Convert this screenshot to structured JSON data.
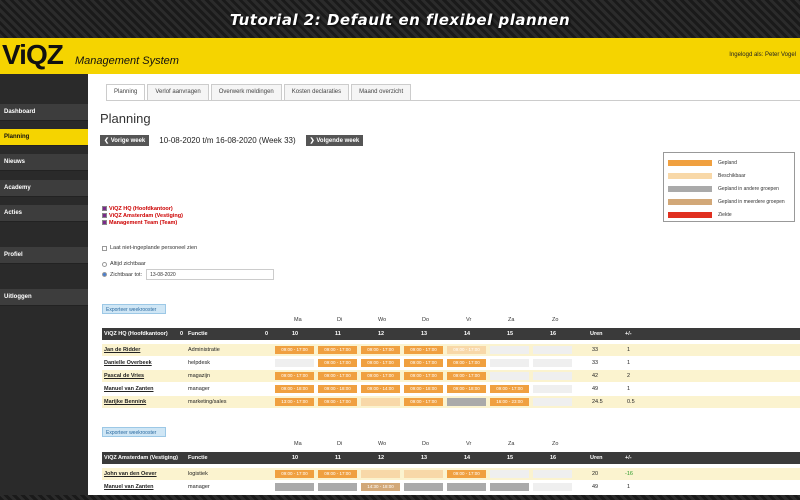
{
  "banner": {
    "title": "Tutorial 2: Default en flexibel plannen"
  },
  "header": {
    "logo": "ViQZ",
    "system_title": "Management System",
    "login_info": "Ingelogd als: Peter Vogel"
  },
  "sidebar": {
    "items": [
      "Dashboard",
      "Planning",
      "Nieuws",
      "Academy",
      "Acties",
      "Profiel",
      "Uitloggen"
    ],
    "active": "Planning"
  },
  "tabs": [
    "Planning",
    "Verlof aanvragen",
    "Overwerk meldingen",
    "Kosten declaraties",
    "Maand overzicht"
  ],
  "page": {
    "title": "Planning",
    "prev_week": "Vorige week",
    "week_range": "10-08-2020 t/m 16-08-2020   (Week 33)",
    "next_week": "Volgende week"
  },
  "legend": [
    {
      "label": "Gepland",
      "color": "#f0a040"
    },
    {
      "label": "Beschikbaar",
      "color": "#f8d8a8"
    },
    {
      "label": "Gepland in andere groepen",
      "color": "#aaaaaa"
    },
    {
      "label": "Gepland in meerdere groepen",
      "color": "#d2a878"
    },
    {
      "label": "Ziekte",
      "color": "#e03020"
    }
  ],
  "groups": [
    "ViQZ HQ (Hoofdkantoor)",
    "ViQZ Amsterdam (Vestiging)",
    "Management Team (Team)"
  ],
  "options": {
    "show_unplanned": "Laat niet-ingeplande personeel zien",
    "always_visible": "Altijd zichtbaar",
    "visible_until": "Zichtbaar tot:",
    "visible_until_date": "13-08-2020"
  },
  "export_label": "Exporteer weekrooster",
  "days": [
    "Ma",
    "Di",
    "Wo",
    "Do",
    "Vr",
    "Za",
    "Zo"
  ],
  "dates": [
    "10",
    "11",
    "12",
    "13",
    "14",
    "15",
    "16"
  ],
  "col_function": "Functie",
  "col_hours": "Uren",
  "col_diff": "+/-",
  "tables": [
    {
      "group": "ViQZ HQ (Hoofdkantoor)",
      "count": "0",
      "count2": "0",
      "rows": [
        {
          "name": "Jan de Ridder",
          "function": "Administratie",
          "hours": "33",
          "diff": "1",
          "cells": [
            [
              "gepland",
              "09:00 - 17:00"
            ],
            [
              "gepland",
              "09:00 - 17:00"
            ],
            [
              "gepland",
              "09:00 - 17:00"
            ],
            [
              "gepland",
              "09:00 - 17:00"
            ],
            [
              "beschikbaar",
              "09:00 - 17:00"
            ],
            [
              "leeg",
              ""
            ],
            [
              "leeg",
              ""
            ]
          ]
        },
        {
          "name": "Danielle Overbeek",
          "function": "helpdesk",
          "hours": "33",
          "diff": "1",
          "cells": [
            [
              "leeg",
              ""
            ],
            [
              "gepland",
              "09:00 - 17:00"
            ],
            [
              "gepland",
              "09:00 - 17:00"
            ],
            [
              "gepland",
              "09:00 - 17:00"
            ],
            [
              "gepland",
              "09:00 - 17:00"
            ],
            [
              "leeg",
              ""
            ],
            [
              "leeg",
              ""
            ]
          ]
        },
        {
          "name": "Pascal de Vries",
          "function": "magazijn",
          "hours": "42",
          "diff": "2",
          "cells": [
            [
              "gepland",
              "09:00 - 17:00"
            ],
            [
              "gepland",
              "09:00 - 17:00"
            ],
            [
              "gepland",
              "09:00 - 17:00"
            ],
            [
              "gepland",
              "09:00 - 17:00"
            ],
            [
              "gepland",
              "09:00 - 17:00"
            ],
            [
              "leeg",
              ""
            ],
            [
              "leeg",
              ""
            ]
          ]
        },
        {
          "name": "Manuel van Zanten",
          "function": "manager",
          "hours": "49",
          "diff": "1",
          "cells": [
            [
              "gepland",
              "09:00 - 18:00"
            ],
            [
              "gepland",
              "09:00 - 18:00"
            ],
            [
              "gepland",
              "09:00 - 14:00"
            ],
            [
              "gepland",
              "09:00 - 18:00"
            ],
            [
              "gepland",
              "09:00 - 18:00"
            ],
            [
              "gepland",
              "09:00 - 17:00"
            ],
            [
              "leeg",
              ""
            ]
          ]
        },
        {
          "name": "Marijke Bennink",
          "function": "marketing/sales",
          "hours": "24.5",
          "diff": "0.5",
          "cells": [
            [
              "gepland",
              "13:00 - 17:00"
            ],
            [
              "gepland",
              "09:00 - 17:00"
            ],
            [
              "beschikbaar",
              ""
            ],
            [
              "gepland",
              "09:00 - 17:00"
            ],
            [
              "andere",
              ""
            ],
            [
              "gepland",
              "16:00 - 23:00"
            ],
            [
              "leeg",
              ""
            ]
          ]
        }
      ]
    },
    {
      "group": "ViQZ Amsterdam (Vestiging)",
      "count": "",
      "count2": "",
      "rows": [
        {
          "name": "John van den Oever",
          "function": "logistiek",
          "hours": "20",
          "diff": "-16",
          "cells": [
            [
              "gepland",
              "09:00 - 17:00"
            ],
            [
              "gepland",
              "09:00 - 17:00"
            ],
            [
              "beschikbaar",
              ""
            ],
            [
              "beschikbaar",
              ""
            ],
            [
              "gepland",
              "09:00 - 17:00"
            ],
            [
              "leeg",
              ""
            ],
            [
              "leeg",
              ""
            ]
          ]
        },
        {
          "name": "Manuel van Zanten",
          "function": "manager",
          "hours": "49",
          "diff": "1",
          "cells": [
            [
              "andere",
              ""
            ],
            [
              "andere",
              ""
            ],
            [
              "meerdere",
              "14:30 - 18:00"
            ],
            [
              "andere",
              ""
            ],
            [
              "andere",
              ""
            ],
            [
              "andere",
              ""
            ],
            [
              "leeg",
              ""
            ]
          ]
        }
      ]
    }
  ]
}
